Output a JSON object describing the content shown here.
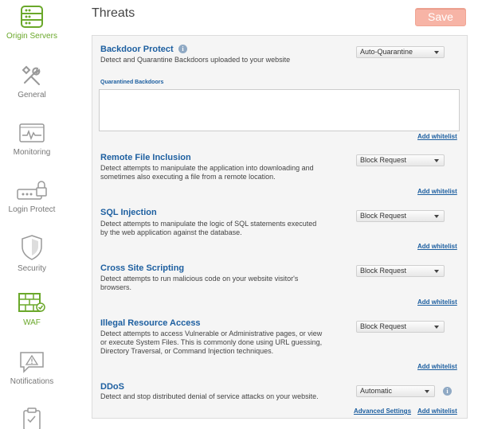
{
  "sidebar": {
    "items": [
      {
        "label": "Origin Servers",
        "icon": "server-icon",
        "active": true
      },
      {
        "label": "General",
        "icon": "tools-icon",
        "active": false
      },
      {
        "label": "Monitoring",
        "icon": "monitor-icon",
        "active": false
      },
      {
        "label": "Login Protect",
        "icon": "lock-icon",
        "active": false
      },
      {
        "label": "Security",
        "icon": "shield-icon",
        "active": false
      },
      {
        "label": "WAF",
        "icon": "firewall-icon",
        "active": true
      },
      {
        "label": "Notifications",
        "icon": "alert-icon",
        "active": false
      }
    ]
  },
  "header": {
    "title": "Threats",
    "save_label": "Save"
  },
  "colors": {
    "active_green": "#6aa82a",
    "link_blue": "#1d5fa0",
    "save_bg": "#f7b4a6"
  },
  "rules": {
    "backdoor": {
      "title": "Backdoor Protect",
      "desc": "Detect and Quarantine Backdoors uploaded to your website",
      "select": "Auto-Quarantine",
      "quarantine_label": "Quarantined Backdoors",
      "link": "Add whitelist"
    },
    "rfi": {
      "title": "Remote File Inclusion",
      "desc1": "Detect attempts to manipulate the application into downloading and",
      "desc2": "sometimes also executing a file from a remote location.",
      "select": "Block Request",
      "link": "Add whitelist"
    },
    "sqli": {
      "title": "SQL Injection",
      "desc1": "Detect attempts to manipulate the logic of SQL statements executed",
      "desc2": "by the web application against the database.",
      "select": "Block Request",
      "link": "Add whitelist"
    },
    "xss": {
      "title": "Cross Site Scripting",
      "desc1": "Detect attempts to run malicious code on your website visitor's",
      "desc2": "browsers.",
      "select": "Block Request",
      "link": "Add whitelist"
    },
    "ira": {
      "title": "Illegal Resource Access",
      "desc1": "Detect attempts to access Vulnerable or Administrative pages, or view",
      "desc2": "or execute System Files. This is commonly done using URL guessing,",
      "desc3": "Directory Traversal, or Command Injection techniques.",
      "select": "Block Request",
      "link": "Add whitelist"
    },
    "ddos": {
      "title": "DDoS",
      "desc": "Detect and stop distributed denial of service attacks on your website.",
      "select": "Automatic",
      "advanced_link": "Advanced Settings",
      "link": "Add whitelist"
    }
  }
}
